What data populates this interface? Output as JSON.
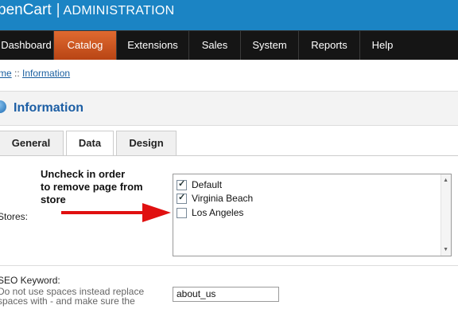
{
  "header": {
    "brand": "penCart",
    "separator": "|",
    "admin_label": "ADMINISTRATION"
  },
  "menu": {
    "items": [
      {
        "label": "Dashboard"
      },
      {
        "label": "Catalog",
        "active": true
      },
      {
        "label": "Extensions"
      },
      {
        "label": "Sales"
      },
      {
        "label": "System"
      },
      {
        "label": "Reports"
      },
      {
        "label": "Help"
      }
    ],
    "active_color": "#c8501c"
  },
  "breadcrumb": {
    "home": "me",
    "sep": "::",
    "current": "Information"
  },
  "heading": {
    "title": "Information"
  },
  "tabs": [
    {
      "label": "General"
    },
    {
      "label": "Data",
      "active": true
    },
    {
      "label": "Design"
    }
  ],
  "annotation": {
    "lines": [
      "Uncheck in order",
      "to remove page from",
      "store"
    ],
    "arrow_color": "#e01010"
  },
  "stores": {
    "label": "Stores:",
    "items": [
      {
        "name": "Default",
        "checked": true
      },
      {
        "name": "Virginia Beach",
        "checked": true
      },
      {
        "name": "Los Angeles",
        "checked": false
      }
    ]
  },
  "seo": {
    "label": "SEO Keyword:",
    "help_lines": [
      "Do not use spaces instead replace",
      "spaces with - and make sure the"
    ],
    "value": "about_us"
  }
}
